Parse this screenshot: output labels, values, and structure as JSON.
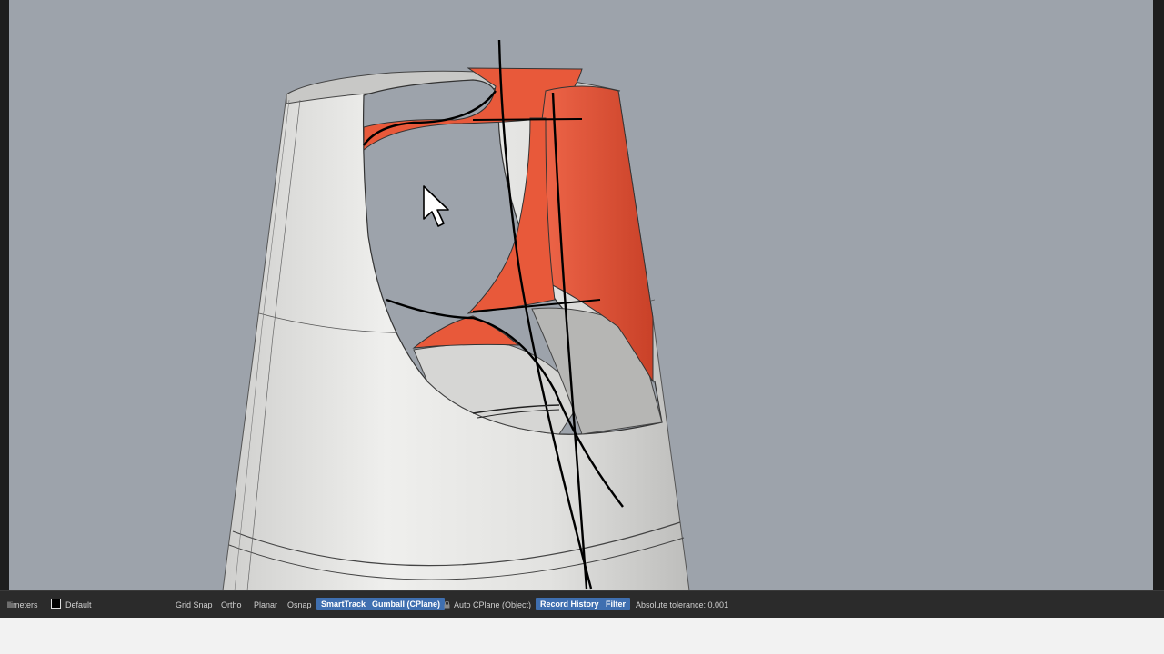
{
  "statusbar": {
    "units": "llimeters",
    "layer": {
      "name": "Default",
      "color": "#000000"
    },
    "panes": {
      "grid_snap": "Grid Snap",
      "ortho": "Ortho",
      "planar": "Planar",
      "osnap": "Osnap",
      "smarttrack": "SmartTrack",
      "gumball": "Gumball (CPlane)",
      "auto_cplane": "Auto CPlane (Object)",
      "record_history": "Record History",
      "filter": "Filter"
    },
    "tolerance": "Absolute tolerance: 0.001",
    "active_color": "#3f6fb0"
  },
  "viewport": {
    "background": "#9da3ab",
    "model_surface_color": "#e3e3e1",
    "selected_surface_color": "#e8593a",
    "curve_color": "#000000"
  },
  "cursor": {
    "icon": "arrow-cursor-icon"
  }
}
